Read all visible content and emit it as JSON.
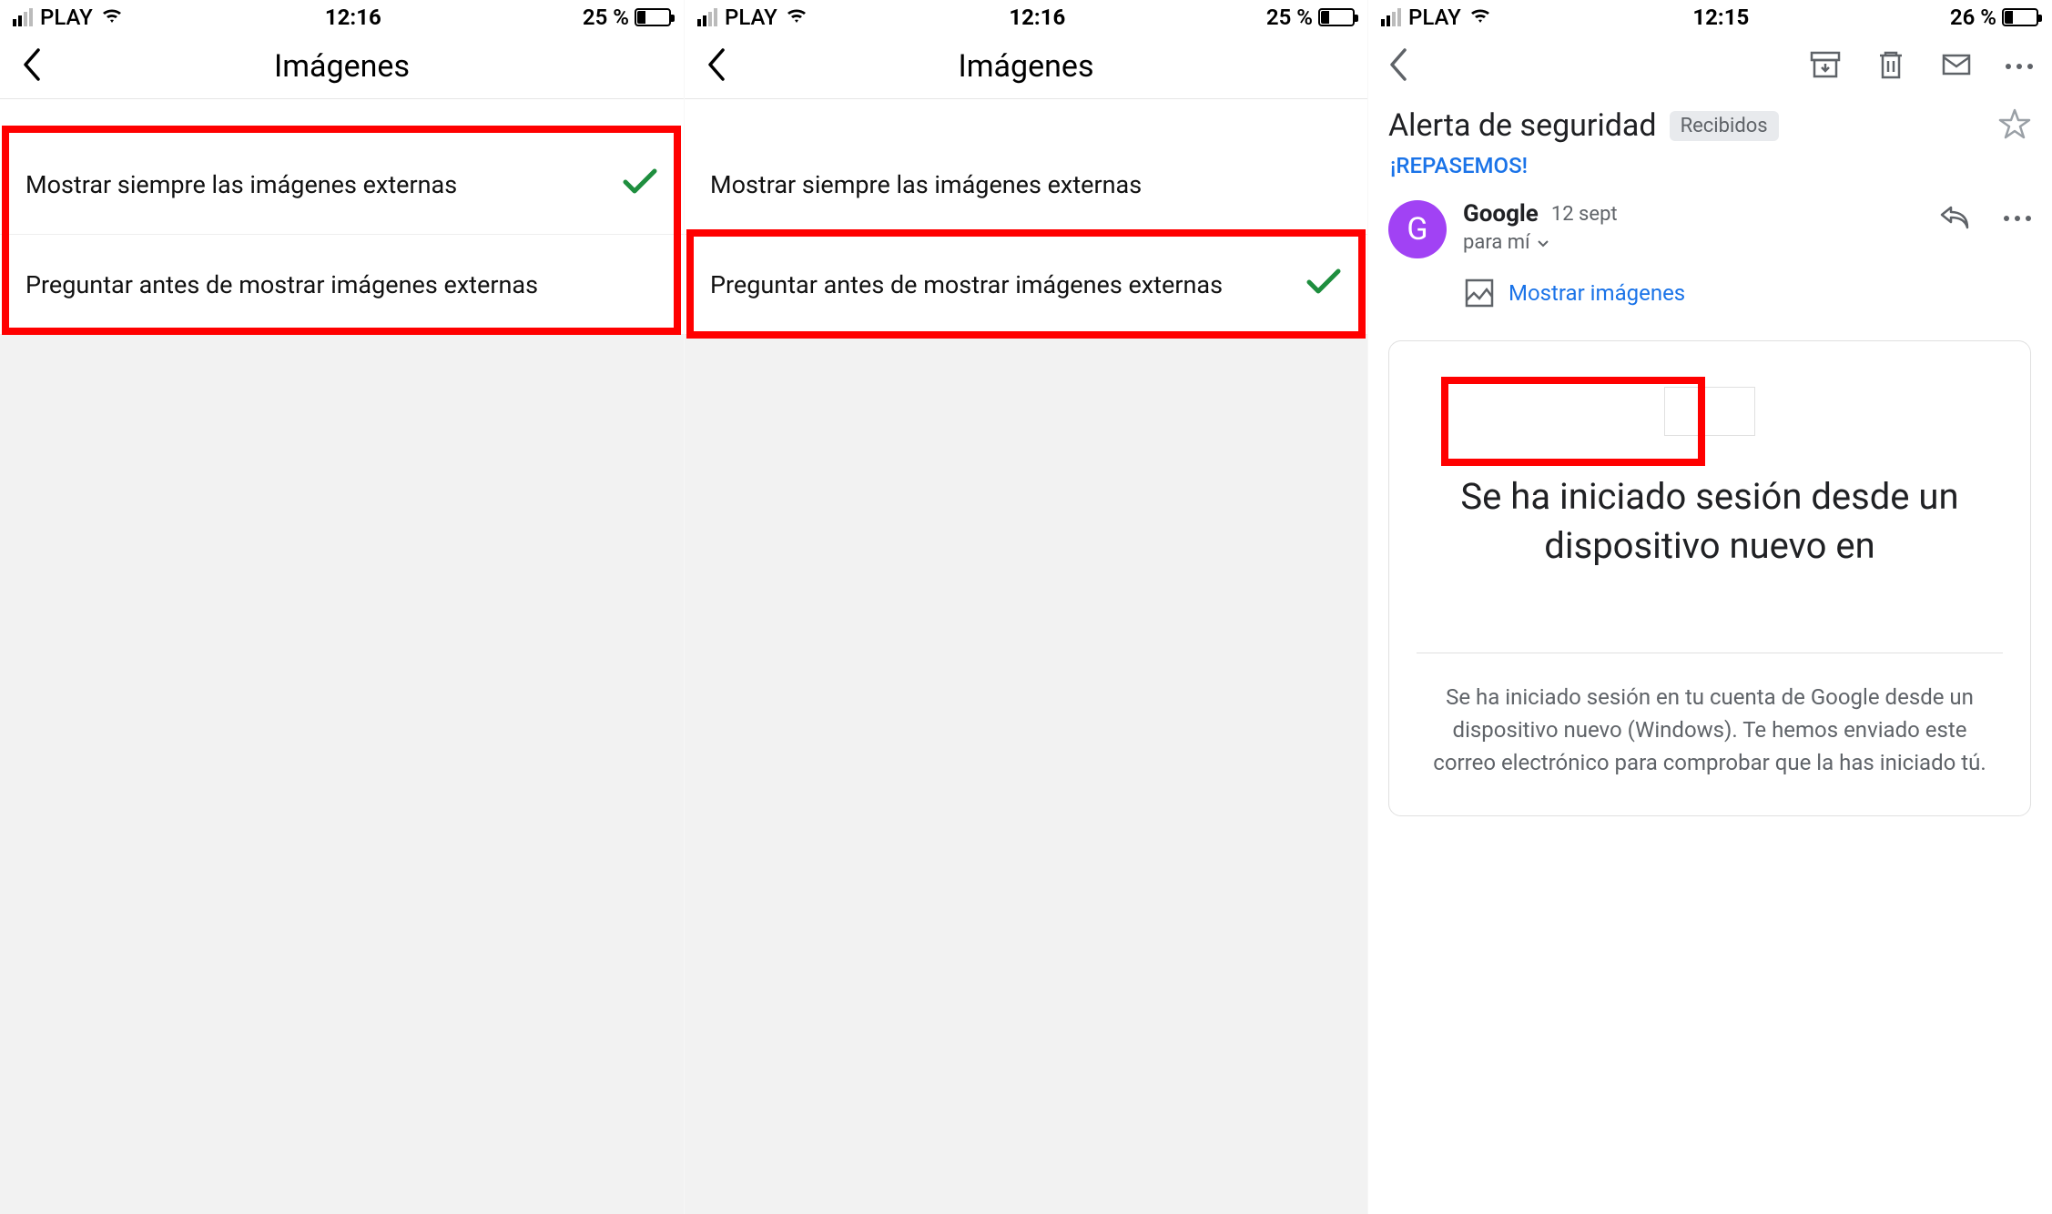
{
  "screen1": {
    "status": {
      "carrier": "PLAY",
      "time": "12:16",
      "battery_pct": "25 %",
      "battery_fill": 25
    },
    "title": "Imágenes",
    "options": [
      {
        "label": "Mostrar siempre las imágenes externas",
        "checked": true
      },
      {
        "label": "Preguntar antes de mostrar imágenes externas",
        "checked": false
      }
    ]
  },
  "screen2": {
    "status": {
      "carrier": "PLAY",
      "time": "12:16",
      "battery_pct": "25 %",
      "battery_fill": 25
    },
    "title": "Imágenes",
    "options": [
      {
        "label": "Mostrar siempre las imágenes externas",
        "checked": false
      },
      {
        "label": "Preguntar antes de mostrar imágenes externas",
        "checked": true
      }
    ]
  },
  "screen3": {
    "status": {
      "carrier": "PLAY",
      "time": "12:15",
      "battery_pct": "26 %",
      "battery_fill": 26
    },
    "subject": "Alerta de seguridad",
    "chip": "Recibidos",
    "top_link": "¡REPASEMOS!",
    "sender": {
      "initial": "G",
      "name": "Google",
      "date": "12 sept",
      "recipient": "para mí"
    },
    "show_images": "Mostrar imágenes",
    "body_heading": "Se ha iniciado sesión desde un dispositivo nuevo en",
    "body_paragraph": "Se ha iniciado sesión en tu cuenta de Google desde un dispositivo nuevo (Windows). Te hemos enviado este correo electrónico para comprobar que la has iniciado tú."
  }
}
